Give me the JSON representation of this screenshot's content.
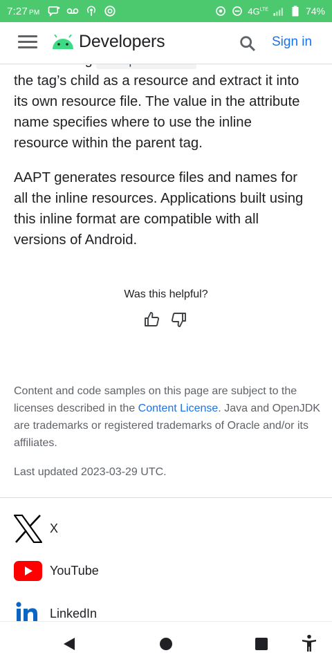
{
  "status_bar": {
    "time": "7:27",
    "ampm": "PM",
    "network": "4G",
    "network_sup": "LTE",
    "battery": "74%"
  },
  "header": {
    "logo_text": "Developers",
    "signin_label": "Sign in",
    "icons": [
      "menu-icon",
      "android-logo-icon",
      "search-icon"
    ]
  },
  "content": {
    "partial_line_before": "The XML tag",
    "partial_code": "<aapt:attr>",
    "partial_line_after": "tells AAPT to treat",
    "paragraph1_lines": [
      "the tag’s child as a resource and extract it into",
      "its own resource file. The value in the attribute",
      "name specifies where to use the inline",
      "resource within the parent tag."
    ],
    "paragraph2_lines": [
      "AAPT generates resource files and names for",
      "all the inline resources. Applications built using",
      "this inline format are compatible with all",
      "versions of Android."
    ]
  },
  "feedback": {
    "question": "Was this helpful?",
    "icons": [
      "thumb-up-icon",
      "thumb-down-icon"
    ]
  },
  "license": {
    "text_before": "Content and code samples on this page are subject to the licenses described in the ",
    "link_text": "Content License",
    "text_after": ". Java and OpenJDK are trademarks or registered trademarks of Oracle and/or its affiliates."
  },
  "last_updated": "Last updated 2023-03-29 UTC.",
  "social": [
    {
      "label": "X",
      "icon": "x-logo-icon"
    },
    {
      "label": "YouTube",
      "icon": "youtube-logo-icon"
    },
    {
      "label": "LinkedIn",
      "icon": "linkedin-logo-icon"
    }
  ],
  "colors": {
    "status_bar": "#4cc96f",
    "link": "#1a73e8",
    "android_green": "#3ddc84",
    "youtube_red": "#ff0000",
    "linkedin_blue": "#0a66c2"
  }
}
